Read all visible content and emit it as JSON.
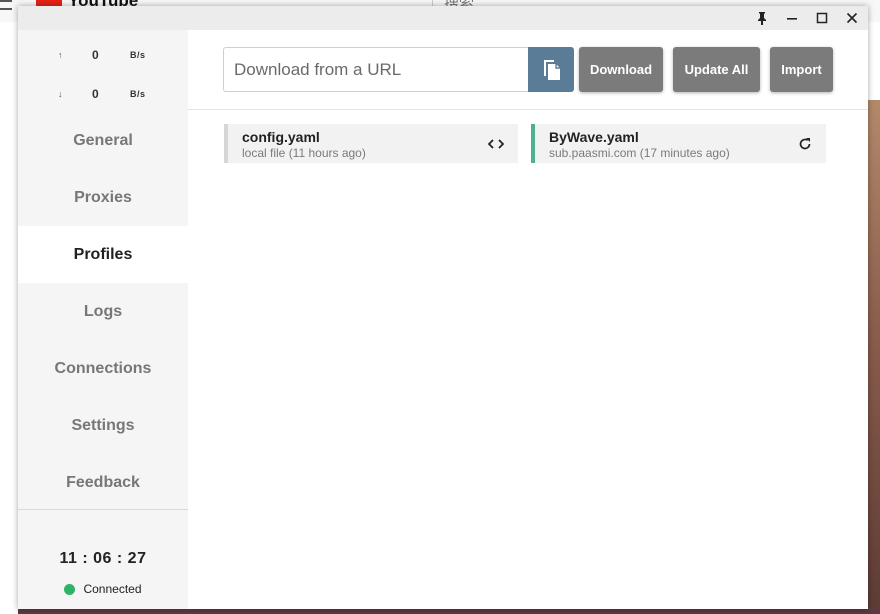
{
  "background": {
    "logo_text": "YouTube",
    "search_text": "搜索"
  },
  "window": {
    "controls": {
      "pin_icon": "pin-icon",
      "minimize_icon": "minimize-icon",
      "maximize_icon": "maximize-icon",
      "close_icon": "close-icon"
    }
  },
  "traffic": {
    "upload": {
      "arrow": "↑",
      "value": "0",
      "unit": "B/s"
    },
    "download": {
      "arrow": "↓",
      "value": "0",
      "unit": "B/s"
    }
  },
  "nav": {
    "items": [
      {
        "label": "General"
      },
      {
        "label": "Proxies"
      },
      {
        "label": "Profiles"
      },
      {
        "label": "Logs"
      },
      {
        "label": "Connections"
      },
      {
        "label": "Settings"
      },
      {
        "label": "Feedback"
      }
    ],
    "active": "Profiles"
  },
  "footer": {
    "clock": "11 : 06 : 27",
    "status": "Connected",
    "status_color": "#2fb467"
  },
  "toolbar": {
    "url_placeholder": "Download from a URL",
    "paste_icon": "paste-icon",
    "download_label": "Download",
    "update_all_label": "Update All",
    "import_label": "Import"
  },
  "profiles": [
    {
      "name": "config.yaml",
      "subtitle": "local file (11 hours ago)",
      "icon": "code-icon",
      "accent": "#d6d6d6"
    },
    {
      "name": "ByWave.yaml",
      "subtitle": "sub.paasmi.com (17 minutes ago)",
      "icon": "refresh-icon",
      "accent": "#4db38d"
    }
  ]
}
